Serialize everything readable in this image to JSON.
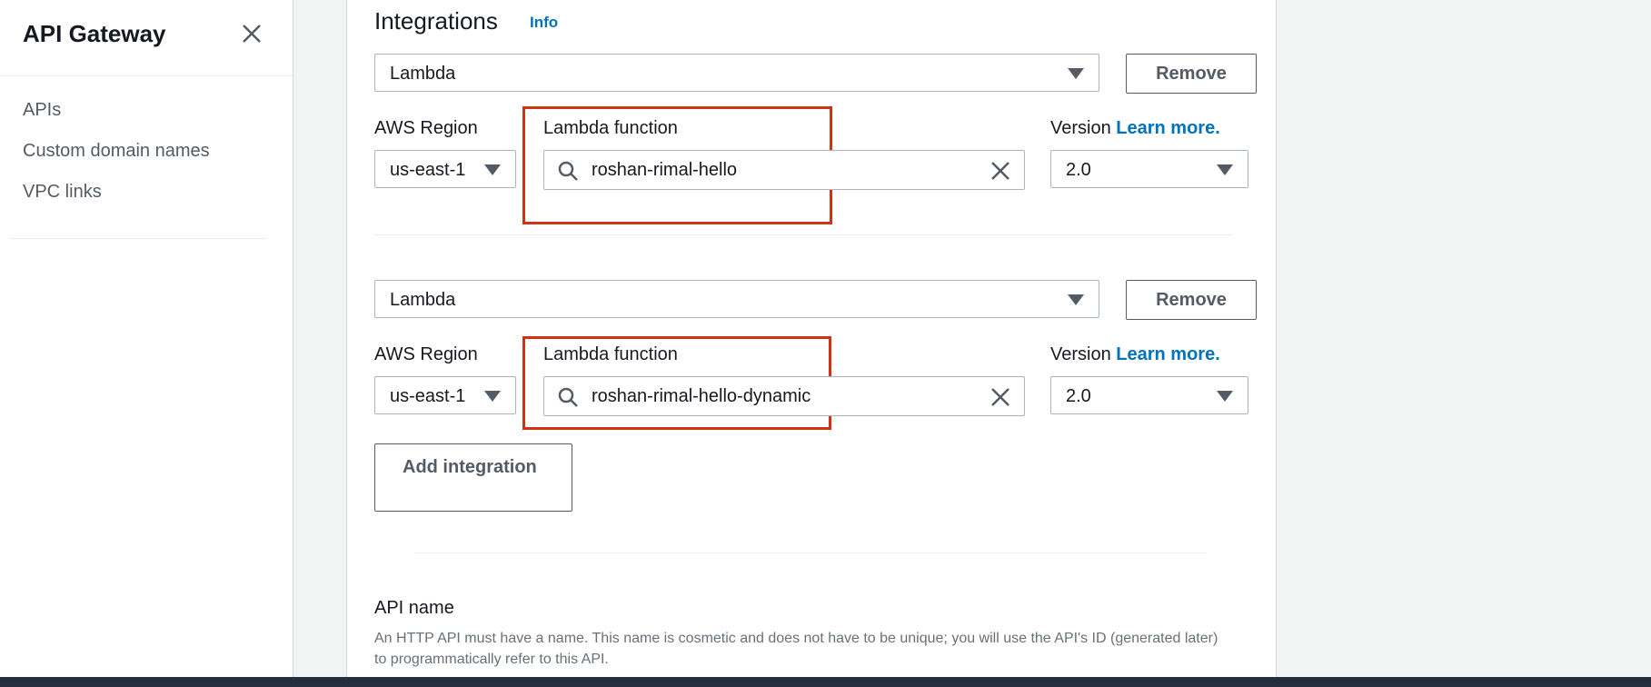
{
  "sidebar": {
    "title": "API Gateway",
    "items": [
      {
        "label": "APIs"
      },
      {
        "label": "Custom domain names"
      },
      {
        "label": "VPC links"
      }
    ]
  },
  "integrations": {
    "title": "Integrations",
    "info": "Info",
    "rows": [
      {
        "type": "Lambda",
        "remove": "Remove",
        "region_label": "AWS Region",
        "region": "us-east-1",
        "function_label": "Lambda function",
        "function_value": "roshan-rimal-hello",
        "version_label": "Version",
        "learn_more": "Learn more.",
        "version": "2.0"
      },
      {
        "type": "Lambda",
        "remove": "Remove",
        "region_label": "AWS Region",
        "region": "us-east-1",
        "function_label": "Lambda function",
        "function_value": "roshan-rimal-hello-dynamic",
        "version_label": "Version",
        "learn_more": "Learn more.",
        "version": "2.0"
      }
    ],
    "add_button": "Add integration"
  },
  "api_name": {
    "label": "API name",
    "description": "An HTTP API must have a name. This name is cosmetic and does not have to be unique; you will use the API's ID (generated later) to programmatically refer to this API."
  },
  "colors": {
    "highlight": "#d13212",
    "link": "#0073bb",
    "bottom_bar": "#232f3e"
  }
}
